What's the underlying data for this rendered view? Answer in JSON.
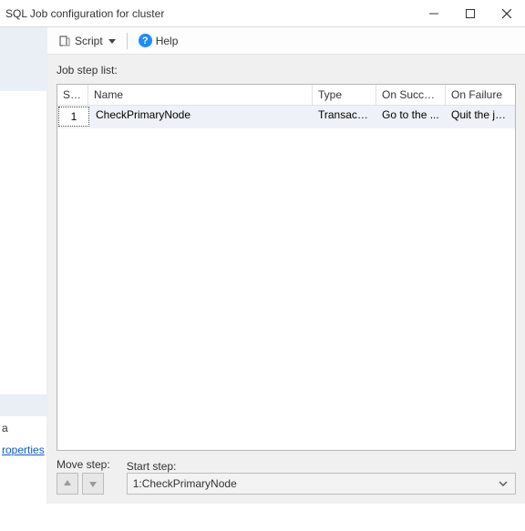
{
  "titlebar": {
    "title": "SQL Job configuration for cluster"
  },
  "toolbar": {
    "script_label": "Script",
    "help_label": "Help"
  },
  "sidebar": {
    "item_a": "a",
    "properties_link": "roperties"
  },
  "main": {
    "list_label": "Job step list:",
    "columns": {
      "step": "St...",
      "name": "Name",
      "type": "Type",
      "on_success": "On Success",
      "on_failure": "On Failure"
    },
    "rows": [
      {
        "step": "1",
        "name": "CheckPrimaryNode",
        "type": "Transact-...",
        "on_success": "Go to the ...",
        "on_failure": "Quit the jo..."
      }
    ],
    "move_step_label": "Move step:",
    "start_step_label": "Start step:",
    "start_step_value": "1:CheckPrimaryNode"
  }
}
